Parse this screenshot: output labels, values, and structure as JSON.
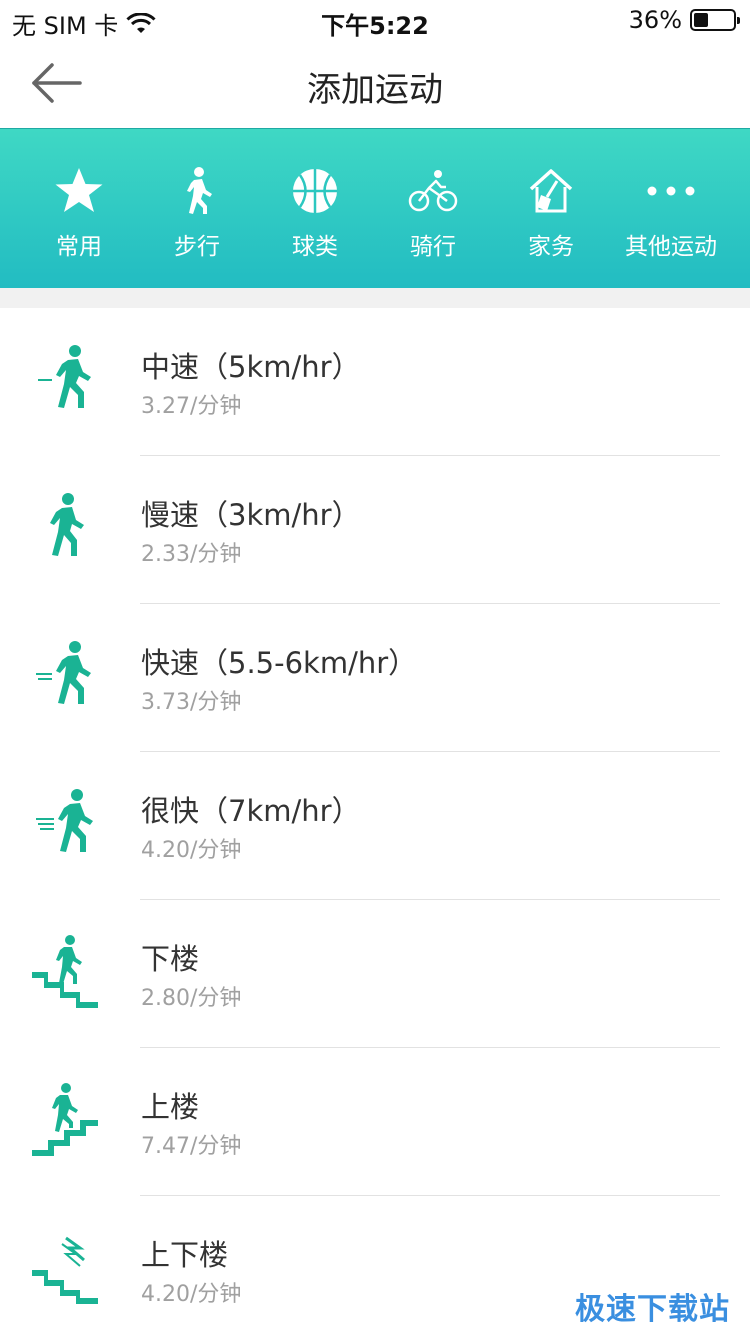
{
  "status_bar": {
    "carrier": "无 SIM 卡",
    "time": "下午5:22",
    "battery_percent": "36%",
    "battery_level": 0.36
  },
  "nav": {
    "title": "添加运动",
    "back_icon": "arrow-left-icon"
  },
  "categories": [
    {
      "label": "常用",
      "icon": "star-icon"
    },
    {
      "label": "步行",
      "icon": "walking-icon"
    },
    {
      "label": "球类",
      "icon": "basketball-icon"
    },
    {
      "label": "骑行",
      "icon": "bicycle-icon"
    },
    {
      "label": "家务",
      "icon": "house-broom-icon"
    },
    {
      "label": "其他运动",
      "icon": "more-icon"
    }
  ],
  "exercises": [
    {
      "name": "中速（5km/hr）",
      "rate": "3.27/分钟",
      "icon": "walking-medium-icon"
    },
    {
      "name": "慢速（3km/hr）",
      "rate": "2.33/分钟",
      "icon": "walking-slow-icon"
    },
    {
      "name": "快速（5.5-6km/hr）",
      "rate": "3.73/分钟",
      "icon": "walking-fast-icon"
    },
    {
      "name": "很快（7km/hr）",
      "rate": "4.20/分钟",
      "icon": "walking-very-fast-icon"
    },
    {
      "name": "下楼",
      "rate": "2.80/分钟",
      "icon": "stairs-down-icon"
    },
    {
      "name": "上楼",
      "rate": "7.47/分钟",
      "icon": "stairs-up-icon"
    },
    {
      "name": "上下楼",
      "rate": "4.20/分钟",
      "icon": "stairs-up-down-icon"
    }
  ],
  "watermark": "极速下载站",
  "colors": {
    "accent": "#1ab394",
    "header_gradient_top": "#3fd8c4",
    "header_gradient_bottom": "#22bcc2"
  }
}
